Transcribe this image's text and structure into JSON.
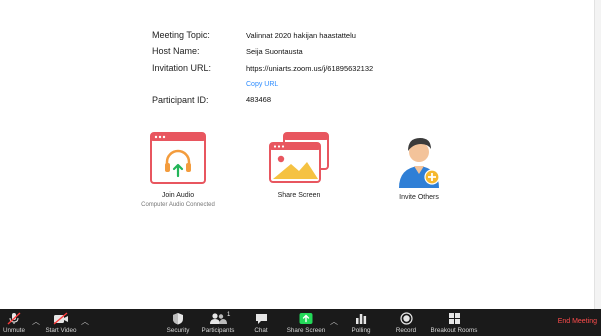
{
  "meeting": {
    "topic_label": "Meeting Topic:",
    "topic_value": "Valinnat 2020 hakijan haastattelu",
    "host_label": "Host Name:",
    "host_value": "Seija Suontausta",
    "url_label": "Invitation URL:",
    "url_value": "https://uniarts.zoom.us/j/61895632132",
    "copy_url": "Copy URL",
    "participant_label": "Participant ID:",
    "participant_value": "483468"
  },
  "actions": {
    "join_audio": "Join Audio",
    "join_audio_sub": "Computer Audio Connected",
    "share_screen": "Share Screen",
    "invite_others": "Invite Others"
  },
  "toolbar": {
    "unmute": "Unmute",
    "start_video": "Start Video",
    "security": "Security",
    "participants": "Participants",
    "participants_count": "1",
    "chat": "Chat",
    "share_screen": "Share Screen",
    "polling": "Polling",
    "record": "Record",
    "breakout_rooms": "Breakout Rooms",
    "end_meeting": "End Meeting"
  },
  "colors": {
    "accent": "#2d8cff",
    "tile_red": "#e8565f",
    "share_green": "#23d959",
    "end_red": "#ff4c4c",
    "toolbar_bg": "#1a1a1a"
  }
}
